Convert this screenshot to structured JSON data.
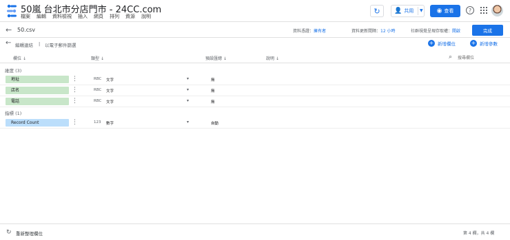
{
  "header": {
    "title": "50嵐 台北市分店門市 - 24CC.com",
    "menu": [
      "檔案",
      "編輯",
      "資料檢視",
      "插入",
      "網頁",
      "排列",
      "資源",
      "說明"
    ],
    "share_label": "共用",
    "view_label": "查看",
    "help_label": "?"
  },
  "subbar": {
    "filename": "50.csv",
    "credentials_label": "資料憑證：",
    "credentials_value": "擁有者",
    "freshness_label": "資料更新間隔：",
    "freshness_value": "12 小時",
    "community_label": "社群視覺呈現存取權：",
    "community_value": "開啟",
    "done_label": "完成"
  },
  "crumbs": {
    "edit_connection": "編輯連結",
    "manage_filters": "以電子郵件篩選",
    "add_field": "新增欄位",
    "add_parameter": "新增參數"
  },
  "columns": {
    "field": "欄位",
    "type": "類型",
    "default_agg": "預設匯總",
    "description": "說明",
    "search_placeholder": "搜尋欄位"
  },
  "dimensions": {
    "label": "維度 (3)",
    "rows": [
      {
        "name": "地址",
        "type_code": "RBC",
        "type_name": "文字",
        "aggregation": "無"
      },
      {
        "name": "店名",
        "type_code": "RBC",
        "type_name": "文字",
        "aggregation": "無"
      },
      {
        "name": "電話",
        "type_code": "RBC",
        "type_name": "文字",
        "aggregation": "無"
      }
    ]
  },
  "metrics": {
    "label": "指標 (1)",
    "rows": [
      {
        "name": "Record Count",
        "type_code": "123",
        "type_name": "數字",
        "aggregation": "自動"
      }
    ]
  },
  "footer": {
    "refresh_label": "重新整理欄位",
    "count_label": "第 4 欄，共 4 欄"
  },
  "colors": {
    "accent": "#1a73e8",
    "dimension_chip": "#c8e6c9",
    "metric_chip": "#bbdefb"
  }
}
